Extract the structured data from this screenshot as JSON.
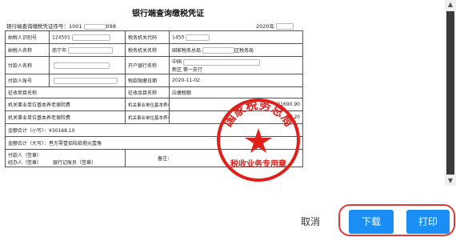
{
  "document": {
    "title": "银行端查询缴税凭证",
    "serial_label": "银行端查询缴税凭证序号：1001",
    "serial_suffix": "098",
    "date_text": "2020年",
    "rows": {
      "taxpayer_id_label": "纳税人识别号",
      "taxpayer_id_value": "124501",
      "tax_office_code_label": "税务机关代码",
      "tax_office_code_value": "1450",
      "taxpayer_name_label": "纳税人名称",
      "taxpayer_name_value": "南宁市",
      "tax_office_name_label": "税务机关名称",
      "tax_office_name_value": "国家税务总局",
      "tax_office_name_suffix": "区税务局",
      "payer_name_label": "付款人名称",
      "bank_label": "开户银行名称",
      "bank_value_line1": "中国",
      "bank_value_line2": "新区 第一支行",
      "payer_account_label": "付款人账号",
      "receipt_date_label": "税款限缴日期",
      "receipt_date_value": "2020-11-02",
      "levy_item_header": "征收项目名称",
      "levy_subitem_header": "征收品目名称",
      "amount_header": "应缴税额",
      "item1_name": "机关事业单位基本养老保险费",
      "item1_sub": "机关事业单位基本养老保险费（单位缴纳）",
      "item1_amount": "21690.90",
      "item2_name": "机关事业单位基本养老保险费",
      "item2_sub": "机关事业单位基本养老保险费（个人缴纳）",
      "item2_amount": "27.20",
      "total_lower_label": "金额合计（小写）：¥30168.10",
      "total_upper_label": "金额合计（大写）：叁万零壹佰陆拾捌元壹角",
      "payer_sign_label": "付款人（签章）",
      "handler_label": "经办人（签章）",
      "bank_sign_label": "银行记账员（签章）",
      "remark_label": "备注："
    },
    "seal": {
      "outer_text": "国家税务总局",
      "inner_text": "税收业务专用章",
      "color": "#e0201b"
    }
  },
  "dialog": {
    "cancel_label": "取消",
    "download_label": "下载",
    "print_label": "打印",
    "primary_color": "#1a8ef5",
    "highlight_color": "#e53935"
  },
  "scrollbar": {
    "up_icon": "▲",
    "down_icon": "▼"
  }
}
